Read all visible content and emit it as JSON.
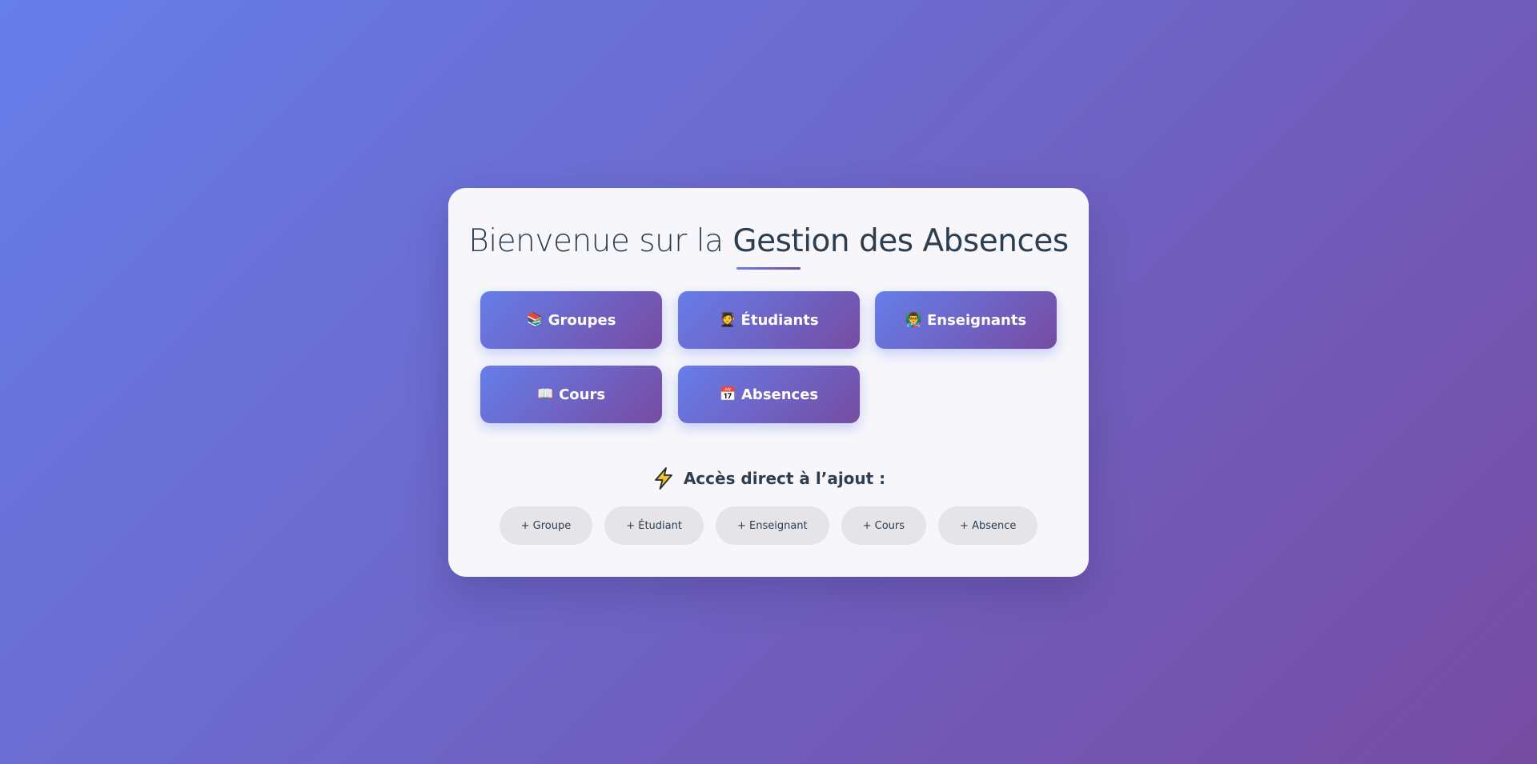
{
  "header": {
    "title_prefix": "Bienvenue sur la ",
    "title_emphasis": "Gestion des Absences"
  },
  "nav": {
    "groupes": {
      "icon": "books-icon",
      "emoji": "📚",
      "label": "Groupes"
    },
    "etudiants": {
      "icon": "student-icon",
      "emoji": "🧑‍🎓",
      "label": "Étudiants"
    },
    "enseignants": {
      "icon": "teacher-icon",
      "emoji": "👨‍🏫",
      "label": "Enseignants"
    },
    "cours": {
      "icon": "open-book-icon",
      "emoji": "📖",
      "label": "Cours"
    },
    "absences": {
      "icon": "calendar-icon",
      "emoji": "📅",
      "label": "Absences"
    }
  },
  "quick_add": {
    "icon": "lightning-icon",
    "heading": "Accès direct à l’ajout :",
    "groupe": "+ Groupe",
    "etudiant": "+ Étudiant",
    "enseignant": "+ Enseignant",
    "cours": "+ Cours",
    "absence": "+ Absence"
  },
  "colors": {
    "gradient_start": "#667eea",
    "gradient_end": "#764ba2",
    "text_dark": "#2c3e50",
    "card_bg": "#f7f7fb",
    "chip_bg": "#e4e4e9",
    "bolt_fill": "#f6c02b"
  }
}
